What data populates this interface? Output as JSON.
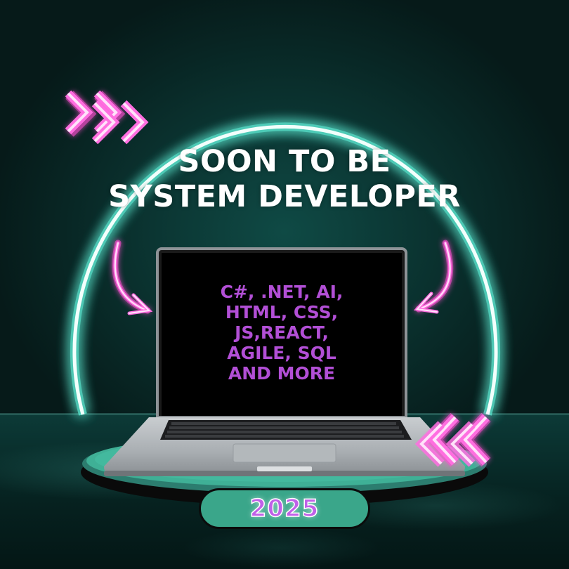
{
  "headline": {
    "line1": "SOON TO BE",
    "line2": "SYSTEM DEVELOPER"
  },
  "screen": {
    "lines": [
      "C#, .NET, AI,",
      "HTML, CSS,",
      "JS,REACT,",
      "AGILE, SQL",
      "AND MORE"
    ]
  },
  "year": "2025",
  "colors": {
    "neon_ring": "#5ff0d8",
    "neon_pink": "#ff4fd2",
    "skills_text": "#b24fd6",
    "pill": "#3aa68a",
    "background": "#0b3532"
  },
  "icons": {
    "top_left": "double-chevron-right-icon",
    "bottom_right": "double-chevron-left-icon",
    "left_arrow": "curved-arrow-down-right-icon",
    "right_arrow": "curved-arrow-down-left-icon"
  }
}
